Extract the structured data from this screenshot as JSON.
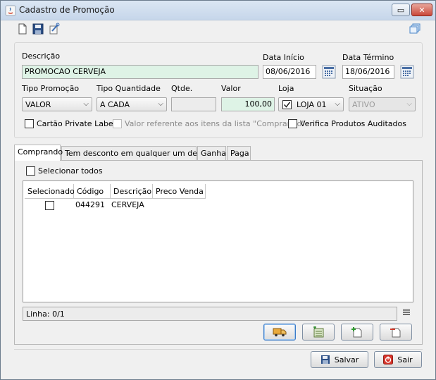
{
  "window": {
    "title": "Cadastro de Promoção",
    "minimize": "▭",
    "close": "✕"
  },
  "form": {
    "descricao_label": "Descrição",
    "descricao_value": "PROMOCAO CERVEJA",
    "data_inicio_label": "Data Início",
    "data_inicio_value": "08/06/2016",
    "data_termino_label": "Data Término",
    "data_termino_value": "18/06/2016",
    "tipo_promocao_label": "Tipo Promoção",
    "tipo_promocao_value": "VALOR",
    "tipo_quantidade_label": "Tipo Quantidade",
    "tipo_quantidade_value": "A CADA",
    "qtde_label": "Qtde.",
    "qtde_value": "",
    "valor_label": "Valor",
    "valor_value": "100,00",
    "loja_label": "Loja",
    "loja_value": "LOJA 01",
    "situacao_label": "Situação",
    "situacao_value": "ATIVO",
    "cartao_label": "Cartão Private Label",
    "valor_referente_label": "Valor referente aos itens da lista \"Comprando\"",
    "verifica_label": "Verifica Produtos Auditados"
  },
  "tabs": [
    "Comprando",
    "Tem desconto em qualquer um desses",
    "Ganha",
    "Paga"
  ],
  "panel": {
    "selecionar_todos": "Selecionar todos",
    "columns": [
      "Selecionado",
      "Código",
      "Descrição",
      "Preco Venda"
    ],
    "rows": [
      {
        "codigo": "044291",
        "descricao": "CERVEJA",
        "preco": ""
      }
    ],
    "status": "Linha: 0/1"
  },
  "footer": {
    "salvar": "Salvar",
    "sair": "Sair"
  },
  "colors": {
    "field_green": "#def3e6",
    "title_bar": "#c6d6ea"
  }
}
